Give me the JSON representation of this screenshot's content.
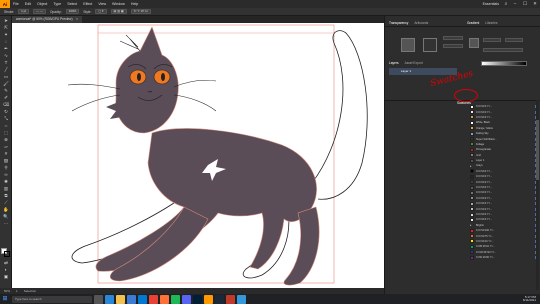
{
  "menubar": {
    "logo": "Ai",
    "items": [
      "File",
      "Edit",
      "Object",
      "Type",
      "Select",
      "Effect",
      "View",
      "Window",
      "Help"
    ],
    "right_label": "Essentials"
  },
  "controlbar": {
    "stroke_label": "Stroke:",
    "stroke_value": "1 pt",
    "opacity_label": "Opacity:",
    "opacity_value": "100%",
    "style_label": "Style:"
  },
  "document": {
    "tab_title": "warriorcat* @ 50% (RGB/GPU Preview)"
  },
  "statusbar": {
    "zoom": "50%",
    "artboard": "1",
    "tool": "Selection"
  },
  "panels": {
    "top_tabs": [
      "Transparency",
      "Artboards"
    ],
    "right_tabs": [
      "Gradient",
      "Libraries"
    ],
    "layers_tabs": [
      "Layers",
      "Asset Export"
    ],
    "layer_name": "Layer 1",
    "swatches_title": "Swatches",
    "groups_title": "Groups"
  },
  "annotation": {
    "text": "Swatches",
    "color": "#e00000"
  },
  "swatches": [
    {
      "name": "C=0 M=0 Y=...",
      "color": "#ffffff",
      "kind": "swatch"
    },
    {
      "name": "C=0 M=0 Y=...",
      "color": "#e8e8e8",
      "kind": "swatch"
    },
    {
      "name": "C=0 M=0 Y=...",
      "color": "#c8a060",
      "kind": "swatch"
    },
    {
      "name": "White, Black",
      "color": "#ffffff",
      "kind": "swatch"
    },
    {
      "name": "Orange, Yellow",
      "color": "#f0a030",
      "kind": "swatch"
    },
    {
      "name": "Fading Sky",
      "color": "#80a0d0",
      "kind": "swatch"
    },
    {
      "name": "Super Soft Black...",
      "color": "#303030",
      "kind": "swatch"
    },
    {
      "name": "Foliage",
      "color": "#4a8a30",
      "kind": "swatch"
    },
    {
      "name": "Pomegranate",
      "color": "#b02030",
      "kind": "swatch"
    },
    {
      "name": "mmf",
      "color": "#8a7a6a",
      "kind": "swatch"
    },
    {
      "name": "Layer 1",
      "color": "#5a4d57",
      "kind": "swatch"
    },
    {
      "name": "Grays",
      "color": "",
      "kind": "folder"
    },
    {
      "name": "C=0 M=0 Y=...",
      "color": "#000000",
      "kind": "swatch"
    },
    {
      "name": "C=0 M=0 Y=...",
      "color": "#262626",
      "kind": "swatch"
    },
    {
      "name": "C=0 M=0 Y=...",
      "color": "#404040",
      "kind": "swatch"
    },
    {
      "name": "C=0 M=0 Y=...",
      "color": "#595959",
      "kind": "swatch"
    },
    {
      "name": "C=0 M=0 Y=...",
      "color": "#737373",
      "kind": "swatch"
    },
    {
      "name": "C=0 M=0 Y=...",
      "color": "#8c8c8c",
      "kind": "swatch"
    },
    {
      "name": "C=0 M=0 Y=...",
      "color": "#a6a6a6",
      "kind": "swatch"
    },
    {
      "name": "C=0 M=0 Y=...",
      "color": "#bfbfbf",
      "kind": "swatch"
    },
    {
      "name": "C=0 M=0 Y=...",
      "color": "#d9d9d9",
      "kind": "swatch"
    },
    {
      "name": "C=0 M=0 Y=...",
      "color": "#f2f2f2",
      "kind": "swatch"
    },
    {
      "name": "Brights",
      "color": "",
      "kind": "folder"
    },
    {
      "name": "C=0 M=100 Y=...",
      "color": "#e61e28",
      "kind": "swatch"
    },
    {
      "name": "C=0 M=75 Y=...",
      "color": "#f26a1e",
      "kind": "swatch"
    },
    {
      "name": "C=0 M=10 Y=...",
      "color": "#ffe600",
      "kind": "swatch"
    },
    {
      "name": "C=85 M=10 Y=...",
      "color": "#00a651",
      "kind": "swatch"
    },
    {
      "name": "C=100 M=90 Y=...",
      "color": "#2e3192",
      "kind": "swatch"
    },
    {
      "name": "C=60 M=90 Y=...",
      "color": "#662d91",
      "kind": "swatch"
    }
  ],
  "taskbar": {
    "search_placeholder": "Type here to search",
    "apps": [
      {
        "name": "task-view",
        "color": "#555555"
      },
      {
        "name": "edge",
        "color": "#2b88d8"
      },
      {
        "name": "file-explorer",
        "color": "#f2c14e"
      },
      {
        "name": "store",
        "color": "#3c7bd6"
      },
      {
        "name": "mail",
        "color": "#0078d4"
      },
      {
        "name": "chrome",
        "color": "#e94235"
      },
      {
        "name": "firefox",
        "color": "#ff7139"
      },
      {
        "name": "spotify",
        "color": "#1db954"
      },
      {
        "name": "discord",
        "color": "#5865f2"
      },
      {
        "name": "photoshop",
        "color": "#001e36"
      },
      {
        "name": "illustrator",
        "color": "#ff9a00"
      },
      {
        "name": "steam",
        "color": "#1b2838"
      },
      {
        "name": "app-red",
        "color": "#c0392b"
      },
      {
        "name": "app-blue",
        "color": "#3498db"
      }
    ],
    "time": "5:17 PM",
    "date": "6/11/2021"
  },
  "colors": {
    "cat_fill": "#5a4d57",
    "eye_color": "#f07820",
    "artboard_guide": "#e8877a"
  }
}
